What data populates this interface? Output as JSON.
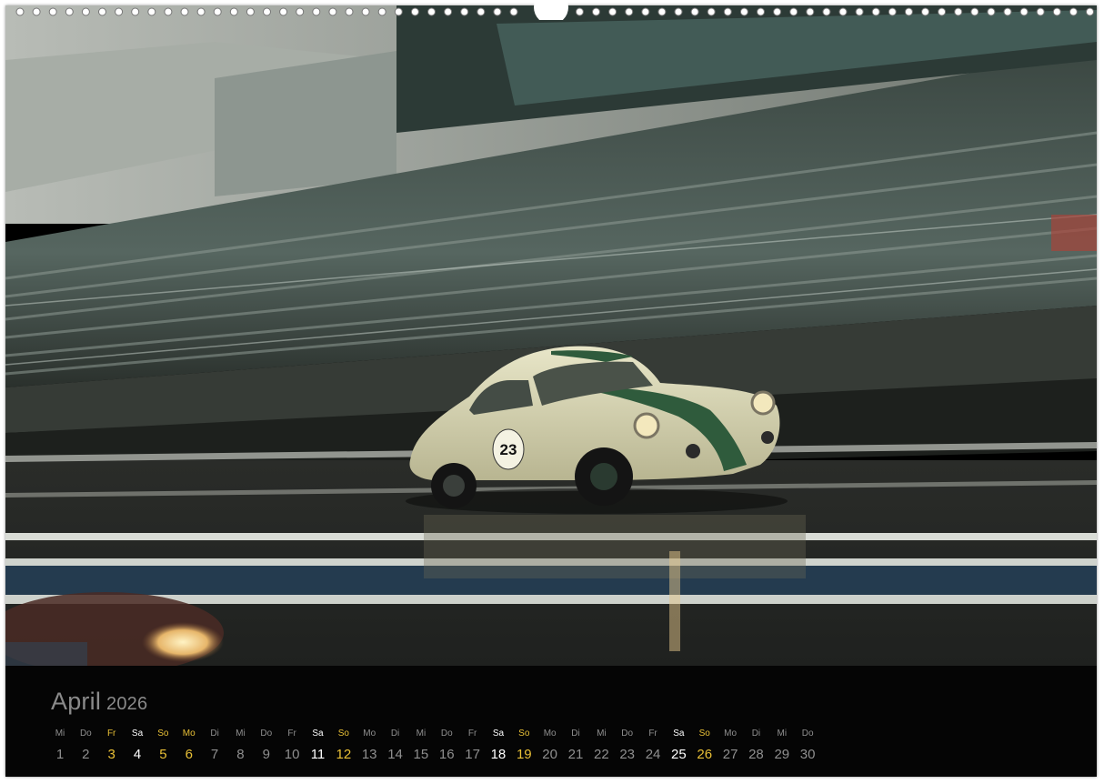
{
  "calendar": {
    "month": "April",
    "year": "2026",
    "days": [
      {
        "label": "Mi",
        "num": "1",
        "type": "normal"
      },
      {
        "label": "Do",
        "num": "2",
        "type": "normal"
      },
      {
        "label": "Fr",
        "num": "3",
        "type": "holiday"
      },
      {
        "label": "Sa",
        "num": "4",
        "type": "saturday"
      },
      {
        "label": "So",
        "num": "5",
        "type": "sunday"
      },
      {
        "label": "Mo",
        "num": "6",
        "type": "holiday"
      },
      {
        "label": "Di",
        "num": "7",
        "type": "normal"
      },
      {
        "label": "Mi",
        "num": "8",
        "type": "normal"
      },
      {
        "label": "Do",
        "num": "9",
        "type": "normal"
      },
      {
        "label": "Fr",
        "num": "10",
        "type": "normal"
      },
      {
        "label": "Sa",
        "num": "11",
        "type": "saturday"
      },
      {
        "label": "So",
        "num": "12",
        "type": "sunday"
      },
      {
        "label": "Mo",
        "num": "13",
        "type": "normal"
      },
      {
        "label": "Di",
        "num": "14",
        "type": "normal"
      },
      {
        "label": "Mi",
        "num": "15",
        "type": "normal"
      },
      {
        "label": "Do",
        "num": "16",
        "type": "normal"
      },
      {
        "label": "Fr",
        "num": "17",
        "type": "normal"
      },
      {
        "label": "Sa",
        "num": "18",
        "type": "saturday"
      },
      {
        "label": "So",
        "num": "19",
        "type": "sunday"
      },
      {
        "label": "Mo",
        "num": "20",
        "type": "normal"
      },
      {
        "label": "Di",
        "num": "21",
        "type": "normal"
      },
      {
        "label": "Mi",
        "num": "22",
        "type": "normal"
      },
      {
        "label": "Do",
        "num": "23",
        "type": "normal"
      },
      {
        "label": "Fr",
        "num": "24",
        "type": "normal"
      },
      {
        "label": "Sa",
        "num": "25",
        "type": "saturday"
      },
      {
        "label": "So",
        "num": "26",
        "type": "sunday"
      },
      {
        "label": "Mo",
        "num": "27",
        "type": "normal"
      },
      {
        "label": "Di",
        "num": "28",
        "type": "normal"
      },
      {
        "label": "Mi",
        "num": "29",
        "type": "normal"
      },
      {
        "label": "Do",
        "num": "30",
        "type": "normal"
      }
    ]
  },
  "photo": {
    "car_number": "23"
  },
  "colors": {
    "highlight": "#e9c036",
    "weekday": "#8f8f8f",
    "saturday": "#ffffff",
    "background": "#050505"
  }
}
